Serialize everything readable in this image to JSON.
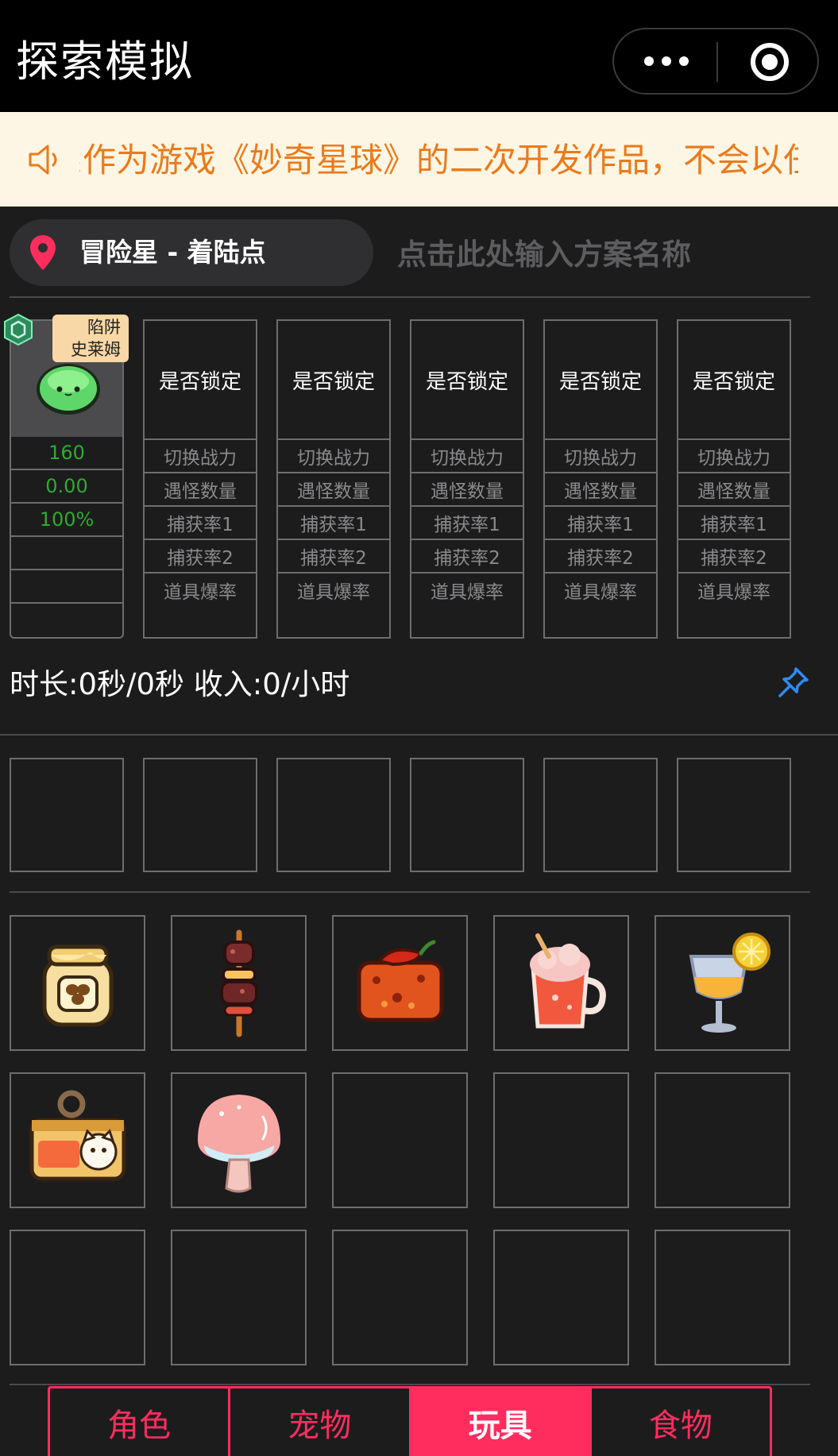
{
  "header": {
    "title": "探索模拟",
    "more_icon": "more-dots-icon",
    "close_icon": "target-circle-icon"
  },
  "notice": {
    "icon": "speaker-icon",
    "text": "系作为游戏《妙奇星球》的二次开发作品，不会以任何形式"
  },
  "location": {
    "icon": "location-pin-icon",
    "label": "冒险星 - 着陆点"
  },
  "plan": {
    "placeholder": "点击此处输入方案名称"
  },
  "pet_card": {
    "icon": "slime-avatar-icon",
    "badge_icon": "hexagon-gem-icon",
    "tag_line1": "陷阱",
    "tag_line2": "史莱姆",
    "values": [
      "160",
      "0.00",
      "100%",
      "",
      "",
      ""
    ]
  },
  "slot_cards": [
    {
      "lock": "是否锁定",
      "rows": [
        "切换战力",
        "遇怪数量",
        "捕获率1",
        "捕获率2",
        "道具爆率"
      ]
    },
    {
      "lock": "是否锁定",
      "rows": [
        "切换战力",
        "遇怪数量",
        "捕获率1",
        "捕获率2",
        "道具爆率"
      ]
    },
    {
      "lock": "是否锁定",
      "rows": [
        "切换战力",
        "遇怪数量",
        "捕获率1",
        "捕获率2",
        "道具爆率"
      ]
    },
    {
      "lock": "是否锁定",
      "rows": [
        "切换战力",
        "遇怪数量",
        "捕获率1",
        "捕获率2",
        "道具爆率"
      ]
    },
    {
      "lock": "是否锁定",
      "rows": [
        "切换战力",
        "遇怪数量",
        "捕获率1",
        "捕获率2",
        "道具爆率"
      ]
    }
  ],
  "summary": {
    "text": "时长:0秒/0秒 收入:0/小时",
    "pin_icon": "pushpin-icon"
  },
  "food_items": [
    {
      "name": "honey-jar-icon"
    },
    {
      "name": "meat-skewer-icon"
    },
    {
      "name": "chili-tofu-icon"
    },
    {
      "name": "milkshake-mug-icon"
    },
    {
      "name": "lemon-drink-icon"
    },
    {
      "name": "cat-can-icon"
    },
    {
      "name": "mushroom-icon"
    }
  ],
  "tabs": [
    {
      "label": "角色",
      "active": false
    },
    {
      "label": "宠物",
      "active": false
    },
    {
      "label": "玩具",
      "active": true
    },
    {
      "label": "食物",
      "active": false
    }
  ],
  "colors": {
    "accent": "#ff2d5e",
    "notice_text": "#ec7a1b",
    "notice_bg": "#fdf6e4",
    "pet_value": "#2cad2c",
    "pin": "#2f8bf0"
  }
}
